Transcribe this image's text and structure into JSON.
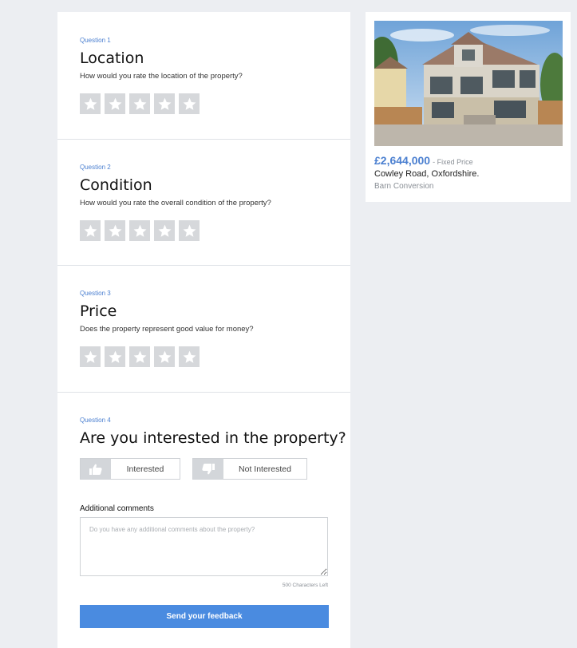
{
  "questions": [
    {
      "number": "Question 1",
      "title": "Location",
      "description": "How would you rate the location of the property?",
      "rating": 0
    },
    {
      "number": "Question 2",
      "title": "Condition",
      "description": "How would you rate the overall condition of the property?",
      "rating": 0
    },
    {
      "number": "Question 3",
      "title": "Price",
      "description": "Does the property represent good value for money?",
      "rating": 0
    },
    {
      "number": "Question 4",
      "title": "Are you interested in the property?",
      "interested_label": "Interested",
      "not_interested_label": "Not Interested"
    }
  ],
  "comments": {
    "label": "Additional comments",
    "placeholder": "Do you have any additional comments about the property?",
    "value": "",
    "chars_left": "500 Characters Left"
  },
  "submit_label": "Send your feedback",
  "property": {
    "price": "£2,644,000",
    "price_type": "- Fixed Price",
    "address": "Cowley Road, Oxfordshire.",
    "type": "Barn Conversion"
  },
  "colors": {
    "accent": "#4a8be0",
    "star_empty": "#d6d8db",
    "background": "#eceef2"
  }
}
